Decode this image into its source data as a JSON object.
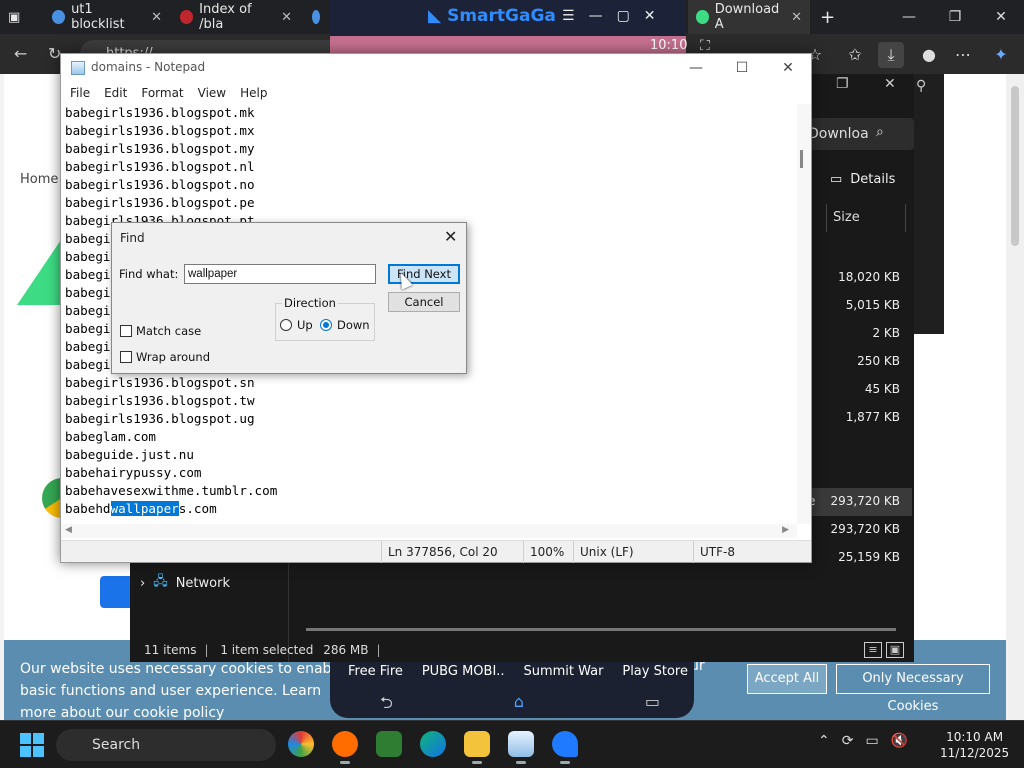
{
  "browser": {
    "tabs": [
      {
        "label": "ut1 blocklist",
        "close": "✕"
      },
      {
        "label": "Index of /bla",
        "close": "✕"
      },
      {
        "label": "Download A",
        "close": "✕"
      }
    ],
    "new_tab": "+",
    "url": "https://...",
    "window_controls": {
      "minimize": "—",
      "maximize": "❐",
      "close": "✕"
    },
    "breadcrumb": "Home"
  },
  "cookie_banner": {
    "text": "Our website uses necessary cookies to enable basic functions and user experience. Learn more about our cookie policy",
    "text_right": "ur",
    "accept": "Accept All",
    "necessary": "Only Necessary Cookies"
  },
  "explorer": {
    "search": "Downloa",
    "details": "Details",
    "size_header": "Size",
    "sizes": [
      "18,020 KB",
      "5,015 KB",
      "2 KB",
      "250 KB",
      "45 KB",
      "1,877 KB",
      "293,720 KB",
      "293,720 KB",
      "25,159 KB"
    ],
    "selected_prefix": "e",
    "network": "Network",
    "status": {
      "items": "11 items",
      "selected": "1 item selected",
      "size": "286 MB"
    }
  },
  "emulator": {
    "title": "SmartGaGa",
    "time": "10:10",
    "apps": [
      "Free Fire",
      "PUBG MOBI..",
      "Summit War",
      "Play Store"
    ]
  },
  "notepad": {
    "title": "domains - Notepad",
    "menu": [
      "File",
      "Edit",
      "Format",
      "View",
      "Help"
    ],
    "lines": [
      "babegirls1936.blogspot.mk",
      "babegirls1936.blogspot.mx",
      "babegirls1936.blogspot.my",
      "babegirls1936.blogspot.nl",
      "babegirls1936.blogspot.no",
      "babegirls1936.blogspot.pe",
      "babegirls1936.blogspot.pt",
      "babegi",
      "babegi",
      "babegi",
      "babegi",
      "babegi",
      "babegi",
      "babegi",
      "babegi",
      "babegirls1936.blogspot.sn",
      "babegirls1936.blogspot.tw",
      "babegirls1936.blogspot.ug",
      "babeglam.com",
      "babeguide.just.nu",
      "babehairypussy.com",
      "babehavesexwithme.tumblr.com"
    ],
    "highlight_line": {
      "before": "babehd",
      "match": "wallpaper",
      "after": "s.com"
    },
    "status": {
      "position": "Ln 377856, Col 20",
      "zoom": "100%",
      "eol": "Unix (LF)",
      "encoding": "UTF-8"
    }
  },
  "find": {
    "title": "Find",
    "label": "Find what:",
    "value": "wallpaper",
    "find_next": "Find Next",
    "cancel": "Cancel",
    "direction": "Direction",
    "up": "Up",
    "down": "Down",
    "direction_value": "down",
    "match_case": "Match case",
    "wrap_around": "Wrap around"
  },
  "taskbar": {
    "search": "Search",
    "time": "10:10 AM",
    "date": "11/12/2025"
  }
}
